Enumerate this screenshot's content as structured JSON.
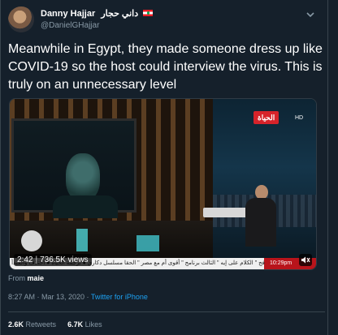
{
  "author": {
    "display_name": "Danny Hajjar",
    "display_name_ar": "داني حجار",
    "handle": "@DanielGHajjar"
  },
  "tweet": {
    "text": "Meanwhile in Egypt, they made someone dress up like COVID-19 so the host could interview the virus. This is truly on an unnecessary level"
  },
  "video": {
    "duration": "2:42",
    "views": "736.5K views",
    "channel_logo_text": "الحياة",
    "channel_quality": "HD",
    "ticker_text": "فج \" الكلام على إيه \" الثالث برنامج \" أقوى أم مع مصر \" الحقا مسلسل دكاري ● ترجمة الحياة ● اختلاف والمبدأ",
    "ticker_time": "10:29pm"
  },
  "source": {
    "prefix": "From",
    "name": "maie"
  },
  "meta": {
    "time": "8:27 AM · Mar 13, 2020 · ",
    "client": "Twitter for iPhone"
  },
  "stats": {
    "retweets_count": "2.6K",
    "retweets_label": "Retweets",
    "likes_count": "6.7K",
    "likes_label": "Likes"
  },
  "colors": {
    "background": "#15202b",
    "text_primary": "#ffffff",
    "text_secondary": "#8899a6",
    "link": "#1da1f2",
    "channel_red": "#d6232a"
  },
  "icons": [
    "chevron-down-icon",
    "egypt-flag-icon",
    "volume-icon"
  ]
}
